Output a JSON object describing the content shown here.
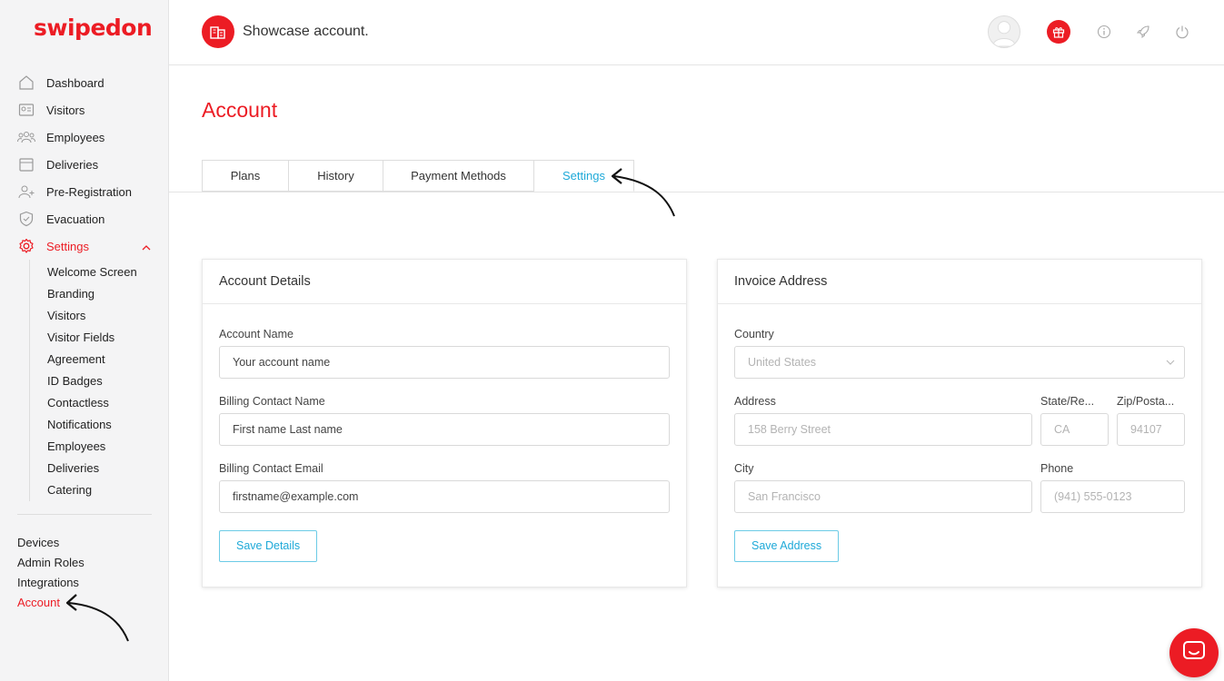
{
  "brand": {
    "logo_text": "swipedon",
    "accent": "#ec1c24",
    "link_color": "#1ea9d8"
  },
  "sidebar": {
    "items": [
      {
        "label": "Dashboard",
        "icon": "home-icon"
      },
      {
        "label": "Visitors",
        "icon": "id-card-icon"
      },
      {
        "label": "Employees",
        "icon": "people-icon"
      },
      {
        "label": "Deliveries",
        "icon": "box-icon"
      },
      {
        "label": "Pre-Registration",
        "icon": "user-plus-icon"
      },
      {
        "label": "Evacuation",
        "icon": "shield-icon"
      },
      {
        "label": "Settings",
        "icon": "gear-icon"
      }
    ],
    "settings_sub": [
      "Welcome Screen",
      "Branding",
      "Visitors",
      "Visitor Fields",
      "Agreement",
      "ID Badges",
      "Contactless",
      "Notifications",
      "Employees",
      "Deliveries",
      "Catering"
    ],
    "bottom": [
      "Devices",
      "Admin Roles",
      "Integrations",
      "Account"
    ]
  },
  "header": {
    "org_name": "Showcase account."
  },
  "page": {
    "title": "Account",
    "tabs": [
      "Plans",
      "History",
      "Payment Methods",
      "Settings"
    ]
  },
  "account_details": {
    "title": "Account Details",
    "account_name_label": "Account Name",
    "account_name_value": "Your account name",
    "billing_name_label": "Billing Contact Name",
    "billing_name_value": "First name Last name",
    "billing_email_label": "Billing Contact Email",
    "billing_email_value": "firstname@example.com",
    "save_label": "Save Details"
  },
  "invoice_address": {
    "title": "Invoice Address",
    "country_label": "Country",
    "country_value": "United States",
    "address_label": "Address",
    "address_placeholder": "158 Berry Street",
    "state_label": "State/Re...",
    "state_placeholder": "CA",
    "zip_label": "Zip/Posta...",
    "zip_placeholder": "94107",
    "city_label": "City",
    "city_placeholder": "San Francisco",
    "phone_label": "Phone",
    "phone_placeholder": "(941) 555-0123",
    "save_label": "Save Address"
  }
}
